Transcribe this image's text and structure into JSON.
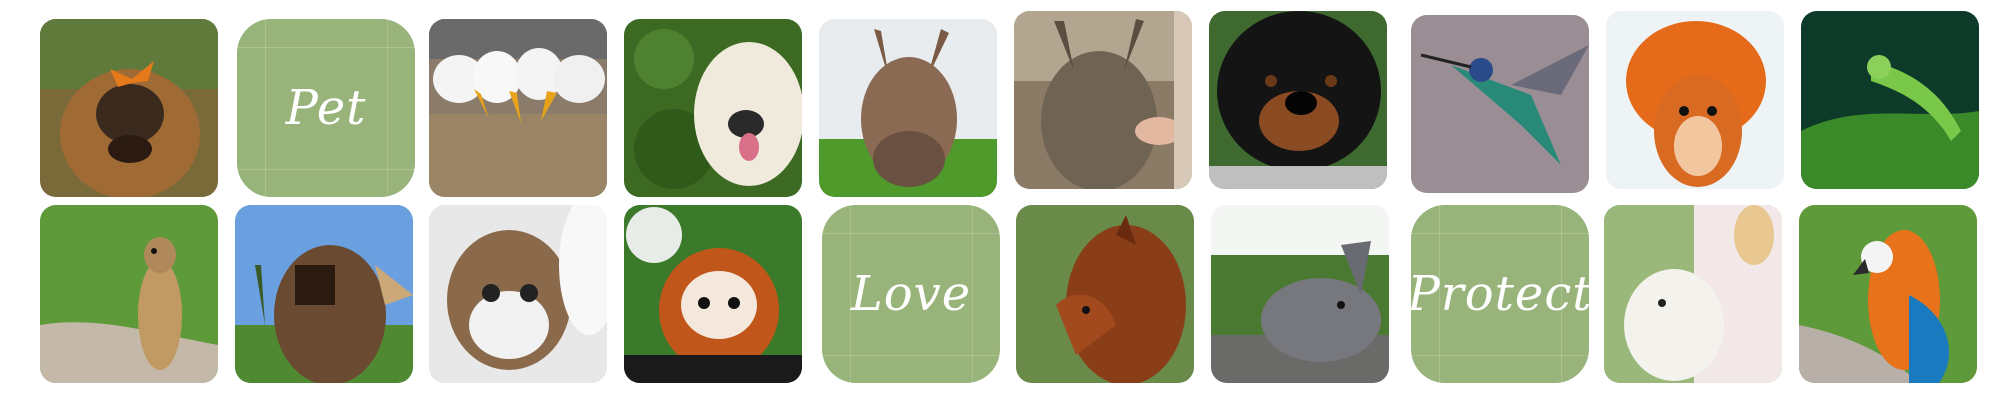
{
  "words": {
    "pet": "Pet",
    "love": "Love",
    "protect": "Protect"
  },
  "colors": {
    "tile_green": "#98b47a",
    "text": "#ffffff",
    "background": "#ffffff"
  },
  "photos": [
    {
      "icon": "dog-with-butterfly-photo"
    },
    {
      "icon": "ducks-photo"
    },
    {
      "icon": "golden-retriever-photo"
    },
    {
      "icon": "donkey-photo"
    },
    {
      "icon": "deer-photo"
    },
    {
      "icon": "rottweiler-photo"
    },
    {
      "icon": "hummingbird-photo"
    },
    {
      "icon": "red-squirrel-photo"
    },
    {
      "icon": "green-lizard-photo"
    },
    {
      "icon": "meerkat-photo"
    },
    {
      "icon": "donkey-palm-photo"
    },
    {
      "icon": "kitten-photo"
    },
    {
      "icon": "red-panda-photo"
    },
    {
      "icon": "horse-photo"
    },
    {
      "icon": "rabbit-photo"
    },
    {
      "icon": "lamb-photo"
    },
    {
      "icon": "macaw-photo"
    }
  ]
}
